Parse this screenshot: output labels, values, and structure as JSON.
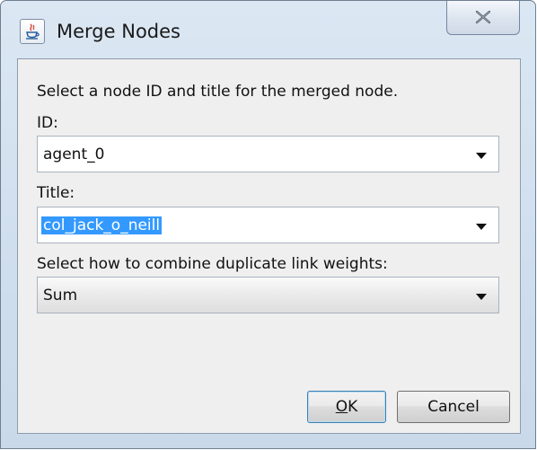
{
  "window": {
    "title": "Merge Nodes",
    "app_icon": "java-icon",
    "close_icon": "close-icon"
  },
  "dialog": {
    "instruction": "Select a node ID and title for the merged node.",
    "id_label": "ID:",
    "id_value": "agent_0",
    "title_label": "Title:",
    "title_value": "col_jack_o_neill",
    "combine_label": "Select how to combine duplicate link weights:",
    "combine_value": "Sum"
  },
  "buttons": {
    "ok_mnemonic": "O",
    "ok_rest": "K",
    "cancel": "Cancel"
  }
}
